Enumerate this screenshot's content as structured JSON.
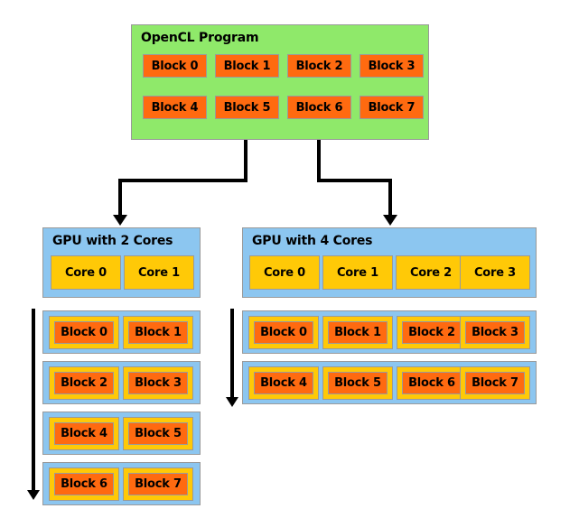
{
  "diagram": {
    "title": "OpenCL Program block scheduling across GPUs with different core counts",
    "colors": {
      "program_panel": "#8fe96a",
      "gpu_panel": "#8cc6f0",
      "block": "#ff6a10",
      "core": "#ffc907",
      "border": "#9a9a9a",
      "arrow": "#000000"
    }
  },
  "program": {
    "label": "OpenCL Program",
    "blocks": [
      "Block 0",
      "Block 1",
      "Block 2",
      "Block 3",
      "Block 4",
      "Block 5",
      "Block 6",
      "Block 7"
    ]
  },
  "gpu_left": {
    "label": "GPU with 2 Cores",
    "cores": [
      "Core 0",
      "Core 1"
    ],
    "schedule_rows": [
      [
        "Block 0",
        "Block 1"
      ],
      [
        "Block 2",
        "Block 3"
      ],
      [
        "Block 4",
        "Block 5"
      ],
      [
        "Block 6",
        "Block 7"
      ]
    ]
  },
  "gpu_right": {
    "label": "GPU with 4 Cores",
    "cores": [
      "Core 0",
      "Core 1",
      "Core 2",
      "Core 3"
    ],
    "schedule_rows": [
      [
        "Block 0",
        "Block 1",
        "Block 2",
        "Block 3"
      ],
      [
        "Block 4",
        "Block 5",
        "Block 6",
        "Block 7"
      ]
    ]
  },
  "arrows": {
    "to_left_gpu": "branch-arrow-to-gpu-with-2-cores",
    "to_right_gpu": "branch-arrow-to-gpu-with-4-cores",
    "time_left": "time-axis-arrow-left",
    "time_right": "time-axis-arrow-right"
  }
}
